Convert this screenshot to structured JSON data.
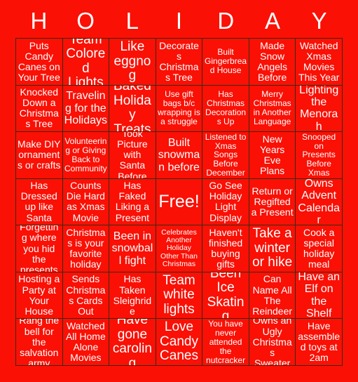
{
  "card": {
    "title_letters": [
      "H",
      "O",
      "L",
      "I",
      "D",
      "A",
      "Y"
    ],
    "background_color": "#fa1005",
    "text_color": "#ffffff",
    "border_color": "#3a2a14",
    "columns": 7,
    "rows": 7,
    "free_space_label": "Free!",
    "free_space_position": {
      "row": 4,
      "col": 4
    }
  },
  "cells": [
    {
      "id": "r1c1",
      "text": "Puts Candy Canes on Your Tree",
      "size": "fs-m"
    },
    {
      "id": "r1c2",
      "text": "Team Colored Lights",
      "size": "fs-xl"
    },
    {
      "id": "r1c3",
      "text": "Like eggnog",
      "size": "fs-xl"
    },
    {
      "id": "r1c4",
      "text": "Decorates Christmas Tree",
      "size": "fs-m"
    },
    {
      "id": "r1c5",
      "text": "Built Gingerbread House",
      "size": "fs-s"
    },
    {
      "id": "r1c6",
      "text": "Made Snow Angels Before",
      "size": "fs-m"
    },
    {
      "id": "r1c7",
      "text": "Watched Xmas Movies This Year",
      "size": "fs-m"
    },
    {
      "id": "r2c1",
      "text": "Knocked Down a Christmas Tree",
      "size": "fs-m"
    },
    {
      "id": "r2c2",
      "text": "Traveling for the Holidays",
      "size": "fs-l"
    },
    {
      "id": "r2c3",
      "text": "Baked Holiday Treats",
      "size": "fs-xl"
    },
    {
      "id": "r2c4",
      "text": "Use gift bags b/c wrapping is a struggle",
      "size": "fs-s"
    },
    {
      "id": "r2c5",
      "text": "Has Christmas Decorations Up",
      "size": "fs-s"
    },
    {
      "id": "r2c6",
      "text": "Merry Christmas in Another Language",
      "size": "fs-s"
    },
    {
      "id": "r2c7",
      "text": "Lighting the Menorah",
      "size": "fs-l"
    },
    {
      "id": "r3c1",
      "text": "Make DIY ornaments or crafts",
      "size": "fs-m"
    },
    {
      "id": "r3c2",
      "text": "Volunteering or Giving Back to Community",
      "size": "fs-s"
    },
    {
      "id": "r3c3",
      "text": "Took Picture with Santa Before",
      "size": "fs-m"
    },
    {
      "id": "r3c4",
      "text": "Built snowman before",
      "size": "fs-l"
    },
    {
      "id": "r3c5",
      "text": "Listened to Xmas Songs Before December",
      "size": "fs-s"
    },
    {
      "id": "r3c6",
      "text": "New Years Eve Plans",
      "size": "fs-m"
    },
    {
      "id": "r3c7",
      "text": "Snooped on Presents Before Xmas",
      "size": "fs-s"
    },
    {
      "id": "r4c1",
      "text": "Has Dressed up like Santa",
      "size": "fs-m"
    },
    {
      "id": "r4c2",
      "text": "Counts Die Hard as Xmas Movie",
      "size": "fs-m"
    },
    {
      "id": "r4c3",
      "text": "Has Faked Liking a Present",
      "size": "fs-m"
    },
    {
      "id": "r4c4",
      "text": "Free!",
      "size": "fs-xxl"
    },
    {
      "id": "r4c5",
      "text": "Go See Holiday Light Display",
      "size": "fs-m"
    },
    {
      "id": "r4c6",
      "text": "Return or Regifted a Present",
      "size": "fs-m"
    },
    {
      "id": "r4c7",
      "text": "Owns Advent Calendar",
      "size": "fs-l"
    },
    {
      "id": "r5c1",
      "text": "Forgetting where you hid the presents",
      "size": "fs-m"
    },
    {
      "id": "r5c2",
      "text": "Christmas is your favorite holiday",
      "size": "fs-m"
    },
    {
      "id": "r5c3",
      "text": "Been in snowball fight",
      "size": "fs-l"
    },
    {
      "id": "r5c4",
      "text": "Celebrates Another Holiday Other Than Christmas",
      "size": "fs-xs"
    },
    {
      "id": "r5c5",
      "text": "Haven't finished buying gifts",
      "size": "fs-m"
    },
    {
      "id": "r5c6",
      "text": "Take a winter or hike",
      "size": "fs-xl"
    },
    {
      "id": "r5c7",
      "text": "Cook a special holiday meal",
      "size": "fs-m"
    },
    {
      "id": "r6c1",
      "text": "Hosting a Party at Your House",
      "size": "fs-m"
    },
    {
      "id": "r6c2",
      "text": "Sends Christmas Cards Out",
      "size": "fs-m"
    },
    {
      "id": "r6c3",
      "text": "Has Taken Sleighride",
      "size": "fs-m"
    },
    {
      "id": "r6c4",
      "text": "Team white lights",
      "size": "fs-xl"
    },
    {
      "id": "r6c5",
      "text": "Been Ice Skating",
      "size": "fs-xl"
    },
    {
      "id": "r6c6",
      "text": "Can Name All The Reindeer",
      "size": "fs-m"
    },
    {
      "id": "r6c7",
      "text": "Have an Elf on the Shelf",
      "size": "fs-l"
    },
    {
      "id": "r7c1",
      "text": "Rang the bell for the salvation army",
      "size": "fs-m"
    },
    {
      "id": "r7c2",
      "text": "Watched All Home Alone Movies",
      "size": "fs-m"
    },
    {
      "id": "r7c3",
      "text": "Have gone caroling",
      "size": "fs-xl"
    },
    {
      "id": "r7c4",
      "text": "Love Candy Canes",
      "size": "fs-xl"
    },
    {
      "id": "r7c5",
      "text": "You have never attended the nutcracker",
      "size": "fs-s"
    },
    {
      "id": "r7c6",
      "text": "Owns an Ugly Christmas Sweater",
      "size": "fs-m"
    },
    {
      "id": "r7c7",
      "text": "Have assembled toys at 2am",
      "size": "fs-m"
    }
  ]
}
